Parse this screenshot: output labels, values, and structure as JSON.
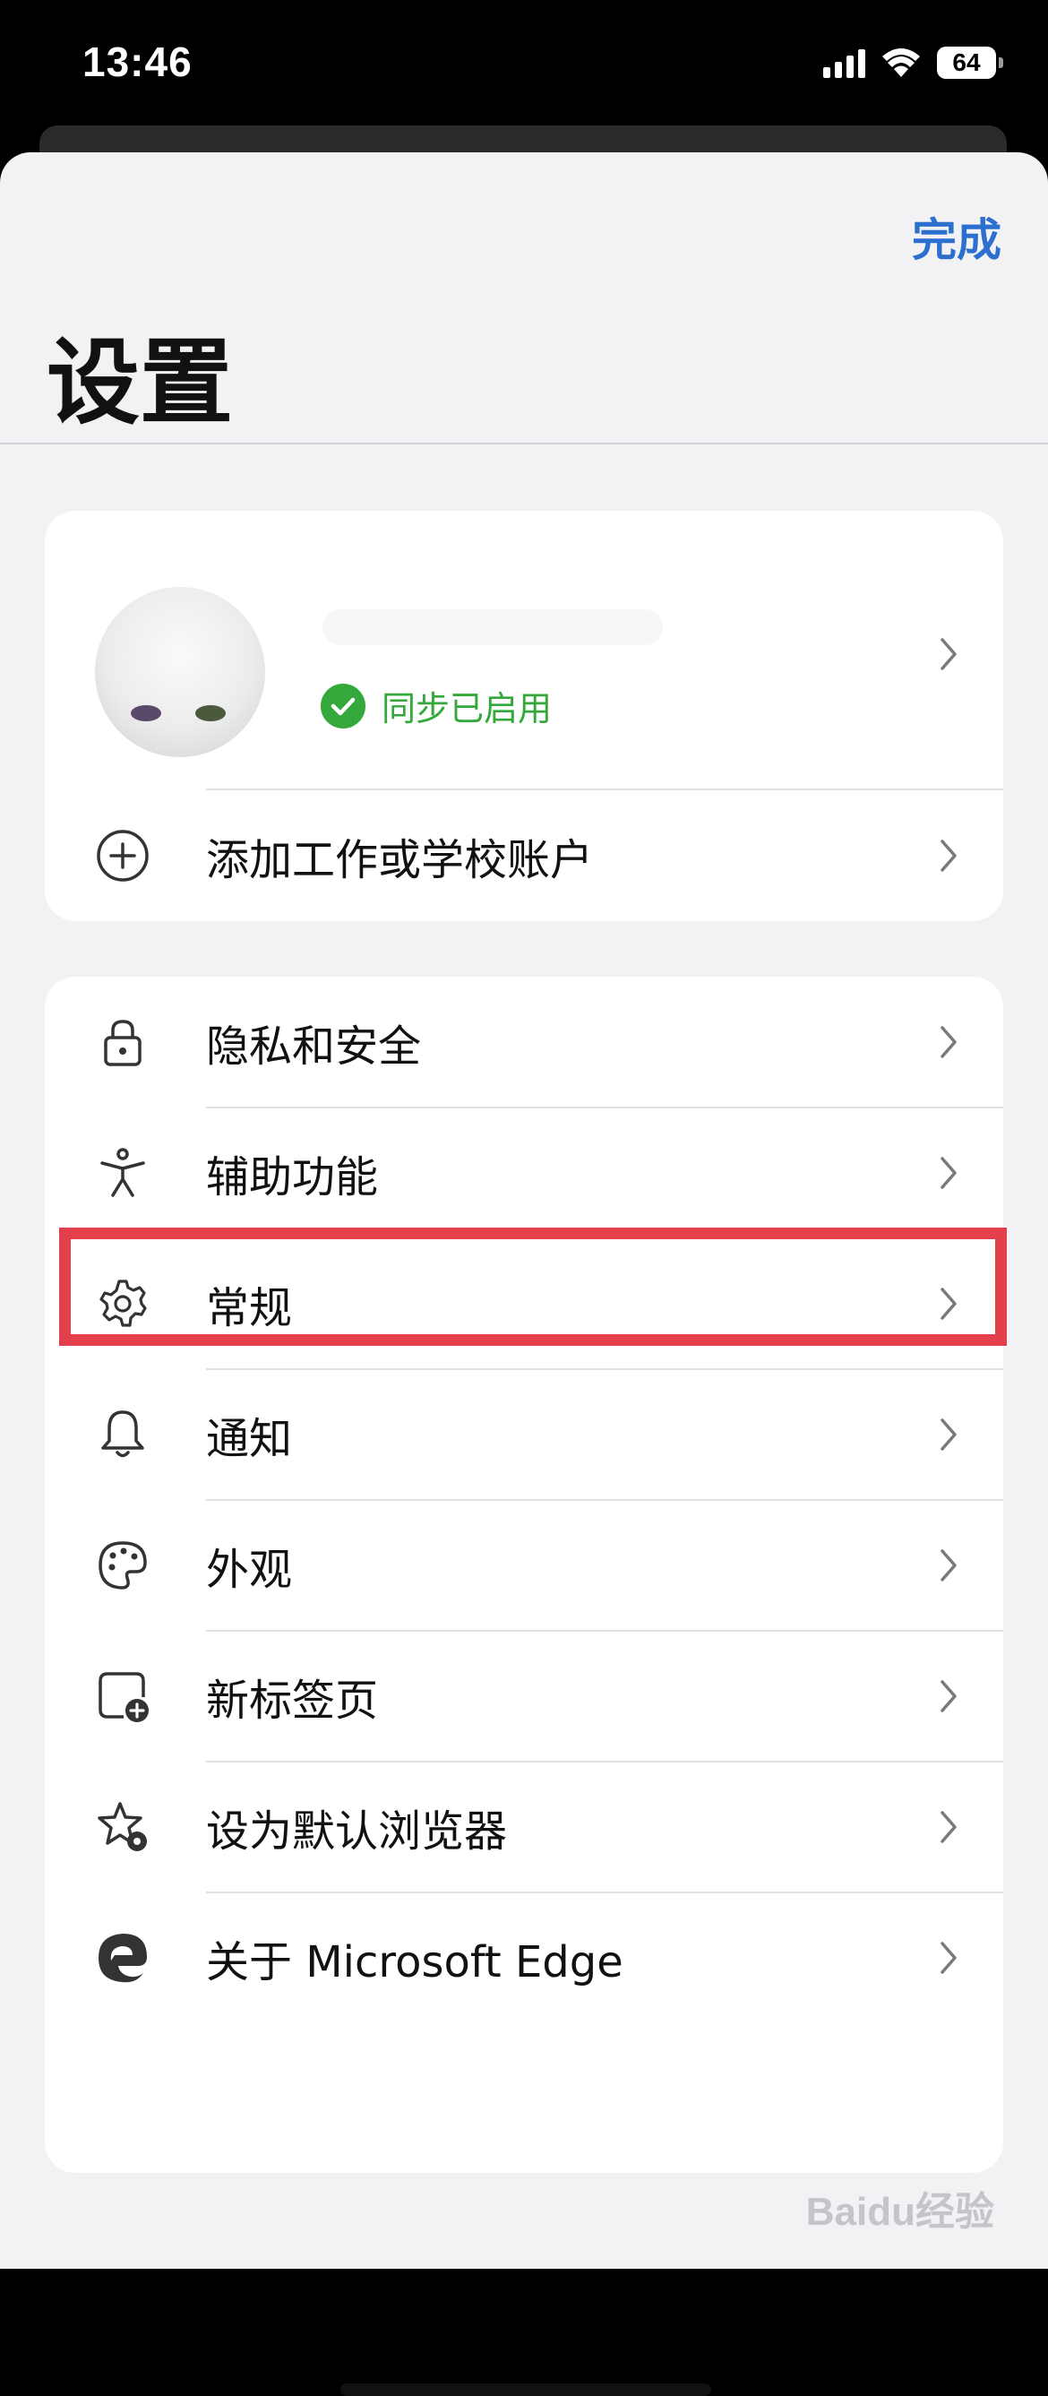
{
  "status_bar": {
    "time": "13:46",
    "battery_level": "64",
    "signal_bars": 4,
    "wifi": "wifi-icon"
  },
  "header": {
    "done_label": "完成",
    "title": "设置"
  },
  "account": {
    "sync_status": "同步已启用",
    "add_account_label": "添加工作或学校账户"
  },
  "settings": {
    "items": [
      {
        "icon": "lock-icon",
        "label": "隐私和安全"
      },
      {
        "icon": "accessibility-icon",
        "label": "辅助功能"
      },
      {
        "icon": "gear-icon",
        "label": "常规"
      },
      {
        "icon": "bell-icon",
        "label": "通知"
      },
      {
        "icon": "palette-icon",
        "label": "外观"
      },
      {
        "icon": "new-tab-icon",
        "label": "新标签页"
      },
      {
        "icon": "star-gear-icon",
        "label": "设为默认浏览器"
      },
      {
        "icon": "edge-logo-icon",
        "label": "关于 Microsoft Edge"
      }
    ]
  },
  "watermark": "Baidu经验",
  "colors": {
    "accent": "#2b6fcf",
    "sync_green": "#34a83a",
    "highlight_red": "#e4404c",
    "sheet_bg": "#f2f2f4"
  }
}
